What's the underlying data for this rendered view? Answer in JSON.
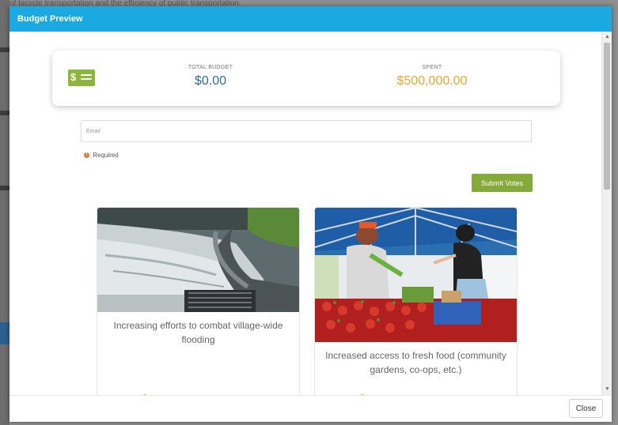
{
  "background": {
    "text": "of bicycle transportation and the efficiency of public transportation."
  },
  "modal": {
    "title": "Budget Preview",
    "close_label": "Close"
  },
  "budget": {
    "total_label": "TOTAL BUDGET",
    "total_value": "$0.00",
    "spent_label": "SPENT",
    "spent_value": "$500,000.00",
    "icon": "money-icon",
    "colors": {
      "total": "#2e6e9a",
      "spent": "#f0a830",
      "icon_bg": "#8cb63c"
    }
  },
  "form": {
    "email_placeholder": "Email",
    "email_value": "",
    "required_label": "Required",
    "submit_label": "Submit Votes"
  },
  "cards": [
    {
      "title": "Increasing efforts to combat village-wide flooding",
      "image": "flooding-street-drain-image"
    },
    {
      "title": "Increased access to fresh food (community gardens, co-ops, etc.)",
      "image": "farmers-market-image"
    }
  ],
  "colors": {
    "header": "#1ba9e1",
    "submit": "#86a93b"
  }
}
